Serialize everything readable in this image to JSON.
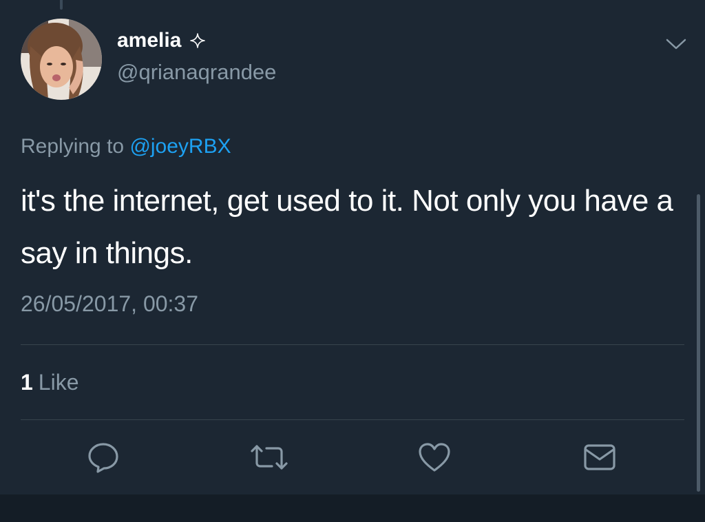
{
  "tweet": {
    "display_name": "amelia",
    "handle": "@qrianaqrandee",
    "replying_prefix": "Replying to",
    "replying_to": "@joeyRBX",
    "text": "it's the internet, get used to it. Not only you have a say in things.",
    "timestamp": "26/05/2017, 00:37",
    "like_count": "1",
    "like_label": "Like"
  },
  "icons": {
    "name_badge": "sparkle-icon",
    "menu": "chevron-down-icon",
    "reply": "reply-icon",
    "retweet": "retweet-icon",
    "like": "heart-icon",
    "dm": "envelope-icon"
  },
  "colors": {
    "background": "#1c2733",
    "text_primary": "#ffffff",
    "text_secondary": "#8899a6",
    "link": "#1da1f2",
    "divider": "#38444d"
  }
}
